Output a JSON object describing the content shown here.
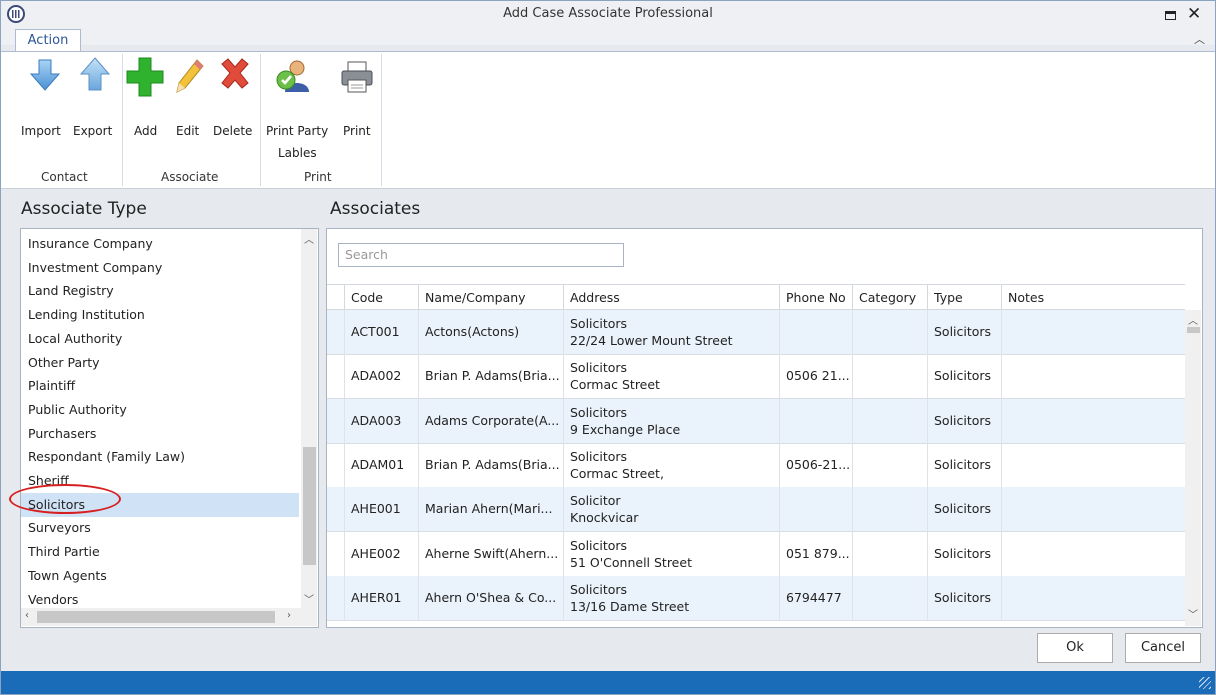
{
  "window": {
    "title": "Add Case Associate Professional"
  },
  "ribbon": {
    "tab": "Action",
    "buttons": {
      "import": "Import",
      "export": "Export",
      "add": "Add",
      "edit": "Edit",
      "delete": "Delete",
      "print_party_1": "Print Party",
      "print_party_2": "Lables",
      "print": "Print"
    },
    "groups": {
      "contact": "Contact",
      "associate": "Associate",
      "print": "Print"
    }
  },
  "left": {
    "title": "Associate Type",
    "items": [
      "Insurance Company",
      "Investment Company",
      "Land Registry",
      "Lending Institution",
      "Local Authority",
      "Other Party",
      "Plaintiff",
      "Public Authority",
      "Purchasers",
      "Respondant (Family Law)",
      "Sheriff",
      "Solicitors",
      "Surveyors",
      "Third Partie",
      "Town Agents",
      "Vendors"
    ],
    "selected": "Solicitors"
  },
  "right": {
    "title": "Associates",
    "search_placeholder": "Search",
    "columns": [
      "Code",
      "Name/Company",
      "Address",
      "Phone No",
      "Category",
      "Type",
      "Notes"
    ],
    "rows": [
      {
        "code": "ACT001",
        "name": "Actons(Actons)",
        "addr1": "Solicitors",
        "addr2": "22/24 Lower Mount Street",
        "phone": "",
        "category": "",
        "type": "Solicitors",
        "notes": ""
      },
      {
        "code": "ADA002",
        "name": "Brian P. Adams(Bria...",
        "addr1": "Solicitors",
        "addr2": "Cormac Street",
        "phone": "0506 21...",
        "category": "",
        "type": "Solicitors",
        "notes": ""
      },
      {
        "code": "ADA003",
        "name": "Adams Corporate(A...",
        "addr1": "Solicitors",
        "addr2": "9 Exchange Place",
        "phone": "",
        "category": "",
        "type": "Solicitors",
        "notes": ""
      },
      {
        "code": "ADAM01",
        "name": "Brian P. Adams(Bria...",
        "addr1": "Solicitors",
        "addr2": "Cormac Street,",
        "phone": "0506-21...",
        "category": "",
        "type": "Solicitors",
        "notes": ""
      },
      {
        "code": "AHE001",
        "name": "Marian Ahern(Mari...",
        "addr1": "Solicitor",
        "addr2": "Knockvicar",
        "phone": "",
        "category": "",
        "type": "Solicitors",
        "notes": ""
      },
      {
        "code": "AHE002",
        "name": "Aherne Swift(Ahern...",
        "addr1": "Solicitors",
        "addr2": "51 O'Connell Street",
        "phone": "051 879...",
        "category": "",
        "type": "Solicitors",
        "notes": ""
      },
      {
        "code": "AHER01",
        "name": "Ahern O'Shea & Co...",
        "addr1": "Solicitors",
        "addr2": "13/16 Dame Street",
        "phone": "6794477",
        "category": "",
        "type": "Solicitors",
        "notes": ""
      }
    ]
  },
  "footer": {
    "ok": "Ok",
    "cancel": "Cancel"
  }
}
